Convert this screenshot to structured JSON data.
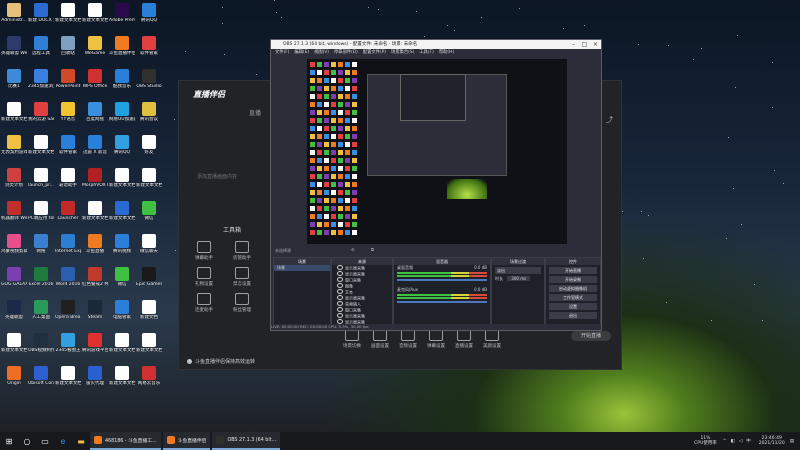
{
  "desktop": {
    "icons": [
      {
        "label": "Administr...",
        "color": "#e6c07a"
      },
      {
        "label": "英雄联盟 WeGame版",
        "color": "#2d3a6a"
      },
      {
        "label": "比赛1",
        "color": "#3f8ad8"
      },
      {
        "label": "新建文本文档.txt",
        "color": "#ffffff"
      },
      {
        "label": "无畏契约游戏",
        "color": "#f0c040"
      },
      {
        "label": "剑灵计划",
        "color": "#d04040"
      },
      {
        "label": "机器翻译 Web...",
        "color": "#c0302a"
      },
      {
        "label": "鸿蒙视频剪辑工具",
        "color": "#e84f8a"
      },
      {
        "label": "GOG GALAXY",
        "color": "#7b3fb0"
      },
      {
        "label": "英雄联盟",
        "color": "#1c2a4a"
      },
      {
        "label": "新建文本文档(2).txt",
        "color": "#ffffff"
      },
      {
        "label": "Origin",
        "color": "#f06d25"
      },
      {
        "label": "新建 DOCX 文档.docx",
        "color": "#2b6ad0"
      },
      {
        "label": "远程工具",
        "color": "#2f7fd8"
      },
      {
        "label": "2345加速浏览器",
        "color": "#3a80e0"
      },
      {
        "label": "我的云游 SamPro",
        "color": "#e04040"
      },
      {
        "label": "新建文本文档(3).txt",
        "color": "#ffffff"
      },
      {
        "label": "launch_pr...",
        "color": "#ffffff"
      },
      {
        "label": "PC端应用 tokens",
        "color": "#ffffff"
      },
      {
        "label": "网络",
        "color": "#3a7fd0"
      },
      {
        "label": "Excel 2016",
        "color": "#1f7a3f"
      },
      {
        "label": "人工桌面",
        "color": "#2a9a5a"
      },
      {
        "label": "OBS视频制作",
        "color": "#203040"
      },
      {
        "label": "Ubisoft Connect",
        "color": "#2d5fd0"
      },
      {
        "label": "新建文本文档(4).txt",
        "color": "#ffffff"
      },
      {
        "label": "回收站",
        "color": "#7fa0c0"
      },
      {
        "label": "PowerPoint",
        "color": "#d04a2a"
      },
      {
        "label": "YY语音",
        "color": "#f2c230"
      },
      {
        "label": "软件管家",
        "color": "#2a7fd8"
      },
      {
        "label": "靠谱助手",
        "color": "#ffffff"
      },
      {
        "label": "Launcher",
        "color": "#c02a2a"
      },
      {
        "label": "Internet Explorer",
        "color": "#2b7fd0"
      },
      {
        "label": "Word 2016",
        "color": "#2b5fb0"
      },
      {
        "label": "Opera Breakpoint",
        "color": "#202020"
      },
      {
        "label": "2345看图王",
        "color": "#30a0e0"
      },
      {
        "label": "新建文本文档(5).txt",
        "color": "#ffffff"
      },
      {
        "label": "新建文本文档(6).txt",
        "color": "#ffffff"
      },
      {
        "label": "WeGame",
        "color": "#f0c040"
      },
      {
        "label": "WPS Office",
        "color": "#d03030"
      },
      {
        "label": "百度网盘",
        "color": "#3a8fe0"
      },
      {
        "label": "迅雷 X 影音",
        "color": "#2a7fd8"
      },
      {
        "label": "MorphVOX Pro",
        "color": "#b02020"
      },
      {
        "label": "新建文本文档(7)",
        "color": "#ffffff"
      },
      {
        "label": "斗鱼直播",
        "color": "#f07a20"
      },
      {
        "label": "红色警戒2 共和国之辉",
        "color": "#c03a2a"
      },
      {
        "label": "Steam",
        "color": "#1b2838"
      },
      {
        "label": "腾讯游戏平台",
        "color": "#e03030"
      },
      {
        "label": "雷火代理",
        "color": "#2a5fd0"
      },
      {
        "label": "Adobe Premiere",
        "color": "#2a0a4a"
      },
      {
        "label": "斗鱼直播伴侣",
        "color": "#f07a20"
      },
      {
        "label": "酷我音乐",
        "color": "#2a7fd8"
      },
      {
        "label": "网易UU加速器",
        "color": "#20a0e0"
      },
      {
        "label": "腾讯QQ",
        "color": "#30a0e0"
      },
      {
        "label": "新建文本文档(8).txt",
        "color": "#ffffff"
      },
      {
        "label": "新建文本文档(9).docx",
        "color": "#2b6ad0"
      },
      {
        "label": "腾讯视频",
        "color": "#2a7fd8"
      },
      {
        "label": "微信",
        "color": "#40c040"
      },
      {
        "label": "电脑管家",
        "color": "#2a7fd8"
      },
      {
        "label": "新建文本文档(10)",
        "color": "#ffffff"
      },
      {
        "label": "新建文本文档(11)",
        "color": "#ffffff"
      },
      {
        "label": "腾讯QQ",
        "color": "#2a7fd8"
      },
      {
        "label": "软件管家",
        "color": "#e04040"
      },
      {
        "label": "OBS Studio",
        "color": "#303030"
      },
      {
        "label": "腾讯会议",
        "color": "#e0c040"
      },
      {
        "label": "好友",
        "color": "#ffffff"
      },
      {
        "label": "新建文本文档",
        "color": "#ffffff"
      },
      {
        "label": "微信",
        "color": "#40c040"
      },
      {
        "label": "微信聊天",
        "color": "#ffffff"
      },
      {
        "label": "Epic Games Launcher",
        "color": "#1a1a1a"
      },
      {
        "label": "新建文档",
        "color": "#ffffff"
      },
      {
        "label": "新建文本文档",
        "color": "#ffffff"
      },
      {
        "label": "网易云音乐",
        "color": "#d03030"
      }
    ]
  },
  "bgapp": {
    "logo": "直播伴侣",
    "tabs": [
      "直播",
      "游戏",
      "视频"
    ],
    "hint": "添加直播画面内容",
    "tools_title": "工具箱",
    "tools": [
      "弹幕助手",
      "房管助手",
      "主播任务",
      "礼物设置",
      "禁言设置",
      "抽奖助手",
      "连麦助手",
      "粉丝管理",
      "更多"
    ],
    "bottom_tools": [
      "场景切换",
      "画面设置",
      "音频设置",
      "弹幕设置",
      "直播设置",
      "美颜设置"
    ],
    "start_button": "开始直播",
    "status": "斗鱼直播伴侣保持高效运转"
  },
  "obs": {
    "title": "OBS 27.1.3 (64 bit, windows) - 配置文件: 未命名 - 场景: 未命名",
    "menu": [
      "文件(F)",
      "编辑(E)",
      "视图(V)",
      "停靠部件(D)",
      "配置文件(P)",
      "场景集合(S)",
      "工具(T)",
      "帮助(H)"
    ],
    "panels": {
      "scenes": {
        "header": "场景",
        "items": [
          "场景"
        ]
      },
      "sources": {
        "header": "来源",
        "items": [
          "显示器采集",
          "显示器采集",
          "窗口采集",
          "图像",
          "文本",
          "显示器采集",
          "音频输入",
          "窗口采集",
          "显示器采集",
          "显示器采集",
          "游戏采集"
        ]
      },
      "mixer": {
        "header": "混音器",
        "tracks": [
          {
            "name": "桌面音频",
            "level": "0.0 dB"
          },
          {
            "name": "麦克风/Aux",
            "level": "0.0 dB"
          }
        ]
      },
      "transitions": {
        "header": "场景过渡",
        "mode": "淡出",
        "duration_label": "时长",
        "duration": "300 ms"
      },
      "controls": {
        "header": "控件",
        "buttons": [
          "开始直播",
          "开始录制",
          "启动虚拟摄像机",
          "工作室模式",
          "设置",
          "退出"
        ]
      }
    },
    "statusbar": "LIVE: 00:00:00   REC: 00:00:00   CPU: 5.3%, 30.00 fps"
  },
  "taskbar": {
    "apps": [
      {
        "label": "468186 - 斗鱼直播工...",
        "color": "#f07a20"
      },
      {
        "label": "斗鱼直播伴侣",
        "color": "#f07a20"
      },
      {
        "label": "OBS 27.1.3 (64 bit...",
        "color": "#303030"
      }
    ],
    "cpu": "11%",
    "cpu_label": "CPU使用率",
    "time": "23:46:49",
    "date": "2021/11/20"
  }
}
